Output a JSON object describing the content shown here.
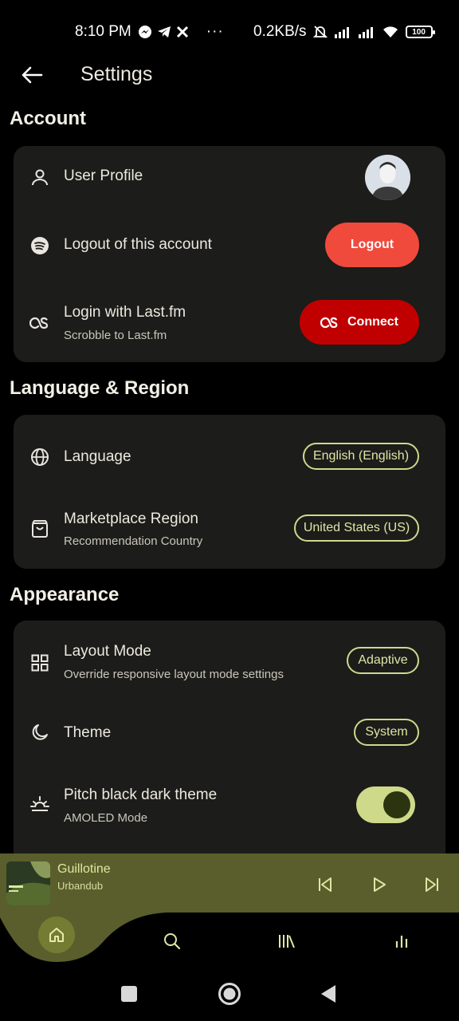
{
  "status_bar": {
    "time": "8:10 PM",
    "notif_icons": [
      "messenger-icon",
      "telegram-icon",
      "x-icon"
    ],
    "more": "···",
    "net_speed": "0.2KB/s",
    "battery": "100"
  },
  "app_bar": {
    "title": "Settings"
  },
  "sections": {
    "account": {
      "title": "Account",
      "user_profile": "User Profile",
      "logout_label": "Logout of this account",
      "logout_button": "Logout",
      "lastfm_label": "Login with Last.fm",
      "lastfm_sub": "Scrobble to Last.fm",
      "connect_button": "Connect"
    },
    "language": {
      "title": "Language & Region",
      "language_label": "Language",
      "language_value": "English (English)",
      "region_label": "Marketplace Region",
      "region_sub": "Recommendation Country",
      "region_value": "United States (US)"
    },
    "appearance": {
      "title": "Appearance",
      "layout_label": "Layout Mode",
      "layout_sub": "Override responsive layout mode settings",
      "layout_value": "Adaptive",
      "theme_label": "Theme",
      "theme_value": "System",
      "pitch_label": "Pitch black dark theme",
      "pitch_sub": "AMOLED Mode",
      "pitch_enabled": true
    }
  },
  "player": {
    "title": "Guillotine",
    "artist": "Urbandub"
  },
  "colors": {
    "accent": "#cfd98a",
    "logout": "#f04a3c",
    "connect": "#c00000",
    "card": "#1c1c1a",
    "player": "#5a5e2c"
  }
}
